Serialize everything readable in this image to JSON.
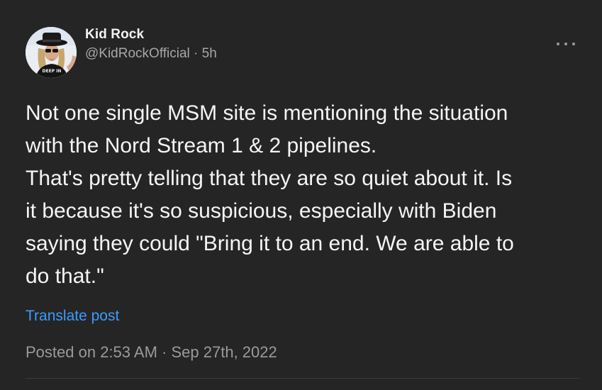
{
  "author": {
    "name": "Kid Rock",
    "handle": "@KidRockOfficial",
    "separator": "·",
    "time_ago": "5h"
  },
  "avatar": {
    "icon": "user-avatar-photo",
    "shirt_text": "DEEP IN"
  },
  "more_icon": "more-horizontal-icon",
  "post": {
    "text": "Not one single MSM site is mentioning the situation\nwith the Nord Stream 1 & 2 pipelines.\nThat's pretty telling that they are so quiet about it. Is\nit because it's so suspicious, especially with Biden\nsaying they could \"Bring it to an end. We are able to\ndo that.\"",
    "translate_label": "Translate post",
    "posted_prefix": "Posted on",
    "posted_time": "2:53 AM",
    "posted_separator": "·",
    "posted_date": "Sep 27th, 2022"
  },
  "colors": {
    "background": "#252525",
    "link": "#3d9bff",
    "text": "#f5f5f5",
    "muted": "#a7a7a7"
  }
}
